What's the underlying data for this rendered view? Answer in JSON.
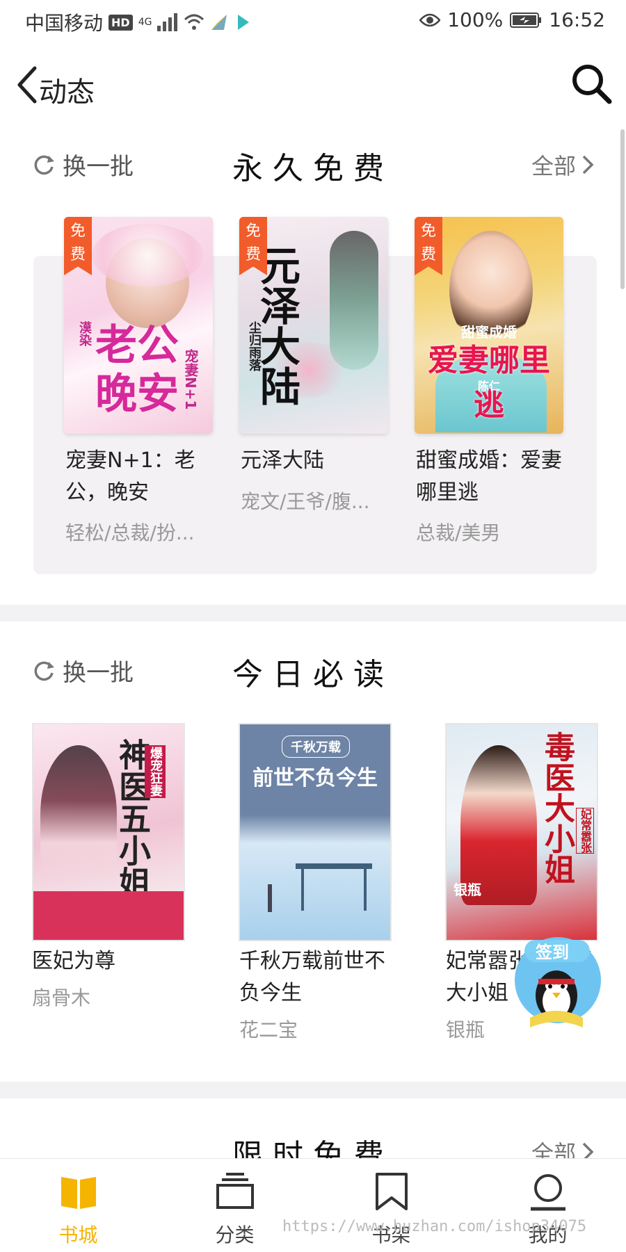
{
  "status_bar": {
    "carrier": "中国移动",
    "hd": "HD",
    "network": "4G",
    "battery": "100%",
    "time": "16:52"
  },
  "header": {
    "title": "动态"
  },
  "section1": {
    "refresh": "换一批",
    "title": "永久免费",
    "all": "全部",
    "books": [
      {
        "badge": "免费",
        "name": "宠妻N+1：老公，晚安",
        "tags": "轻松/总裁/扮...",
        "cover_text": "老公晚安",
        "cover_sub": "宠妻N+1",
        "cover_author": "漠染"
      },
      {
        "badge": "免费",
        "name": "元泽大陆",
        "tags": "宠文/王爷/腹...",
        "cover_text": "元泽大陆",
        "cover_sub": "尘归雨落",
        "cover_author": ""
      },
      {
        "badge": "免费",
        "name": "甜蜜成婚：爱妻哪里逃",
        "tags": "总裁/美男",
        "cover_text": "爱妻哪里逃",
        "cover_sub": "甜蜜成婚",
        "cover_author": "陈仁"
      }
    ]
  },
  "section2": {
    "refresh": "换一批",
    "title": "今日必读",
    "books": [
      {
        "name": "医妃为尊",
        "author": "扇骨木",
        "cover_text": "神医五小姐",
        "cover_sub": "爆宠狂妻"
      },
      {
        "name": "千秋万载前世不负今生",
        "author": "花二宝",
        "cover_text": "前世不负今生",
        "cover_sub": "千秋万载"
      },
      {
        "name": "妃常嚣张：毒医大小姐",
        "author": "银瓶",
        "cover_text": "毒医大小姐",
        "cover_sub": "妃常嚣张"
      }
    ]
  },
  "section3": {
    "title": "限时免费",
    "all": "全部"
  },
  "signin": {
    "label": "签到"
  },
  "tabbar": {
    "tabs": [
      {
        "label": "书城"
      },
      {
        "label": "分类"
      },
      {
        "label": "书架"
      },
      {
        "label": "我的"
      }
    ]
  },
  "watermark": "https://www.huzhan.com/ishop34075",
  "colors": {
    "accent": "#f5b400",
    "badge": "#f25b2a"
  }
}
